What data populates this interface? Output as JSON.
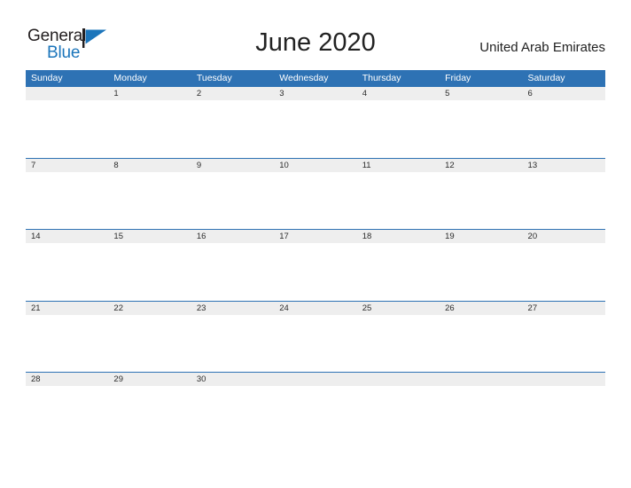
{
  "brand": {
    "name_part1": "General",
    "name_part2": "Blue",
    "flag_icon": "triangle-flag-icon",
    "accent_color": "#1b75bb"
  },
  "header": {
    "title": "June 2020",
    "country": "United Arab Emirates"
  },
  "theme": {
    "header_blue": "#2e72b4",
    "band_gray": "#eeeeee",
    "text_dark": "#222222",
    "text_white": "#ffffff"
  },
  "calendar": {
    "day_headers": [
      "Sunday",
      "Monday",
      "Tuesday",
      "Wednesday",
      "Thursday",
      "Friday",
      "Saturday"
    ],
    "weeks": [
      [
        "",
        "1",
        "2",
        "3",
        "4",
        "5",
        "6"
      ],
      [
        "7",
        "8",
        "9",
        "10",
        "11",
        "12",
        "13"
      ],
      [
        "14",
        "15",
        "16",
        "17",
        "18",
        "19",
        "20"
      ],
      [
        "21",
        "22",
        "23",
        "24",
        "25",
        "26",
        "27"
      ],
      [
        "28",
        "29",
        "30",
        "",
        "",
        "",
        ""
      ]
    ]
  }
}
